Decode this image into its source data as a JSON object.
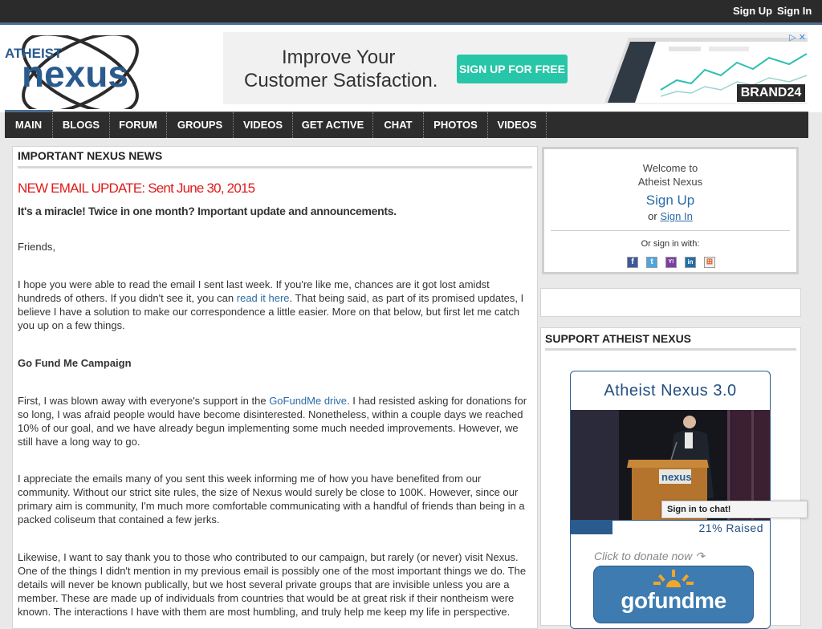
{
  "topbar": {
    "signup": "Sign Up",
    "signin": "Sign In"
  },
  "logo": {
    "top": "ATHEIST",
    "main": "nexus"
  },
  "ad": {
    "headline_1": "Improve Your",
    "headline_2": "Customer Satisfaction.",
    "button": "SIGN UP FOR FREE",
    "brand": "BRAND24"
  },
  "nav": {
    "items": [
      "MAIN",
      "BLOGS",
      "FORUM",
      "GROUPS",
      "VIDEOS",
      "GET ACTIVE",
      "CHAT",
      "PHOTOS",
      "VIDEOS"
    ]
  },
  "main": {
    "heading": "IMPORTANT NEXUS NEWS",
    "update_title": "NEW EMAIL UPDATE: Sent June 30, 2015",
    "subhead": "It's a miracle! Twice in one month? Important update and announcements.",
    "greeting": "Friends,",
    "p1_a": "I hope you were able to read the email I sent last week. If you're like me, chances are it got lost amidst hundreds of others. If you didn't see it, you can ",
    "p1_link": "read it here",
    "p1_b": ". That being said, as part of its promised updates, I believe I have a solution to make our correspondence a little easier. More on that below, but first let me catch you up on a few things.",
    "section_title": "Go Fund Me Campaign",
    "p2_a": "First, I was blown away with everyone's support in the ",
    "p2_link": "GoFundMe drive",
    "p2_b": ". I had resisted asking for donations for so long, I was afraid people would have become disinterested. Nonetheless, within a couple days we reached 10% of our goal, and we have already begun implementing some much needed improvements. However, we still have a long way to go.",
    "p3": "I appreciate the emails many of you sent this week informing me of how you have benefited from our community. Without our strict site rules, the size of Nexus would surely be close to 100K. However, since our primary aim is community, I'm much more comfortable communicating with a handful of friends than being in a packed coliseum that contained a few jerks.",
    "p4": "Likewise, I want to say thank you to those who contributed to our campaign, but rarely (or never) visit Nexus. One of the things I didn't mention in my previous email is possibly one of the most important things we do. The details will never be known publically, but we host several private groups that are invisible unless you are a member. These are made up of individuals from countries that would be at great risk if their nontheism were known. The interactions I have with them are most humbling, and truly help me keep my life in perspective."
  },
  "welcome": {
    "line1": "Welcome to",
    "line2": "Atheist Nexus",
    "signup": "Sign Up",
    "or": "or",
    "signin": "Sign In",
    "or_sign_in_with": "Or sign in with:",
    "social": [
      {
        "icon": "facebook-icon",
        "color": "#3b5998",
        "glyph": "f"
      },
      {
        "icon": "twitter-icon",
        "color": "#4da7de",
        "glyph": "t"
      },
      {
        "icon": "yahoo-icon",
        "color": "#7b3fa0",
        "glyph": "Y!"
      },
      {
        "icon": "linkedin-icon",
        "color": "#1f6fa8",
        "glyph": "in"
      },
      {
        "icon": "windows-icon",
        "color": "#f0f0f0",
        "glyph": "⊞"
      }
    ]
  },
  "support": {
    "heading": "SUPPORT ATHEIST NEXUS",
    "card_title": "Atheist Nexus 3.0",
    "podium_logo": "nexus",
    "raised_fraction": 0.21,
    "raised_text": "21% Raised",
    "donate_prompt": "Click to donate now",
    "gofundme": "gofundme"
  },
  "chat": {
    "label": "Sign in to chat!"
  },
  "colors": {
    "accent": "#4a6e93",
    "link": "#2a6ca8",
    "alert": "#e01b1b",
    "ad_button": "#27c6a8"
  }
}
